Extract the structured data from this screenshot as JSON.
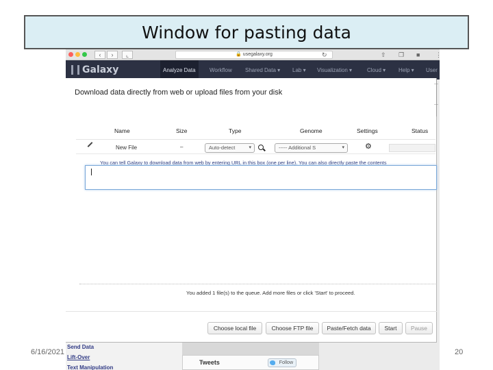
{
  "slide": {
    "title": "Window for pasting data",
    "date": "6/16/2021",
    "page_number": "20"
  },
  "browser": {
    "url": "usegalaxy.org",
    "back_icon": "chevron-left-icon",
    "forward_icon": "chevron-right-icon",
    "reload_icon": "reload-icon"
  },
  "masthead": {
    "brand": "Galaxy",
    "nav": [
      "Analyze Data",
      "Workflow",
      "Shared Data ▾",
      "Lab ▾",
      "Visualization ▾",
      "Cloud ▾",
      "Help ▾",
      "User"
    ],
    "active_index": 0,
    "bg_color": "#2c3143"
  },
  "background_page": {
    "tool_links": [
      "Send Data",
      "Lift-Over",
      "Text Manipulation"
    ],
    "tweets_label": "Tweets",
    "follow_label": "Follow"
  },
  "upload_dialog": {
    "title": "Download data directly from web or upload files from your disk",
    "columns": [
      "Name",
      "Size",
      "Type",
      "Genome",
      "Settings",
      "Status"
    ],
    "row": {
      "name": "New File",
      "size": "–",
      "type": "Auto-detect",
      "genome": "----- Additional S",
      "edit_icon": "pencil-icon",
      "search_icon": "search-icon",
      "settings_icon": "gear-icon"
    },
    "hint": "You can tell Galaxy to download data from web by entering URL in this box (one per line). You can also directly paste the contents",
    "paste_value": "",
    "queue_message": "You added 1 file(s) to the queue. Add more files or click 'Start' to proceed.",
    "buttons": [
      "Choose local file",
      "Choose FTP file",
      "Paste/Fetch data",
      "Start",
      "Pause"
    ]
  }
}
